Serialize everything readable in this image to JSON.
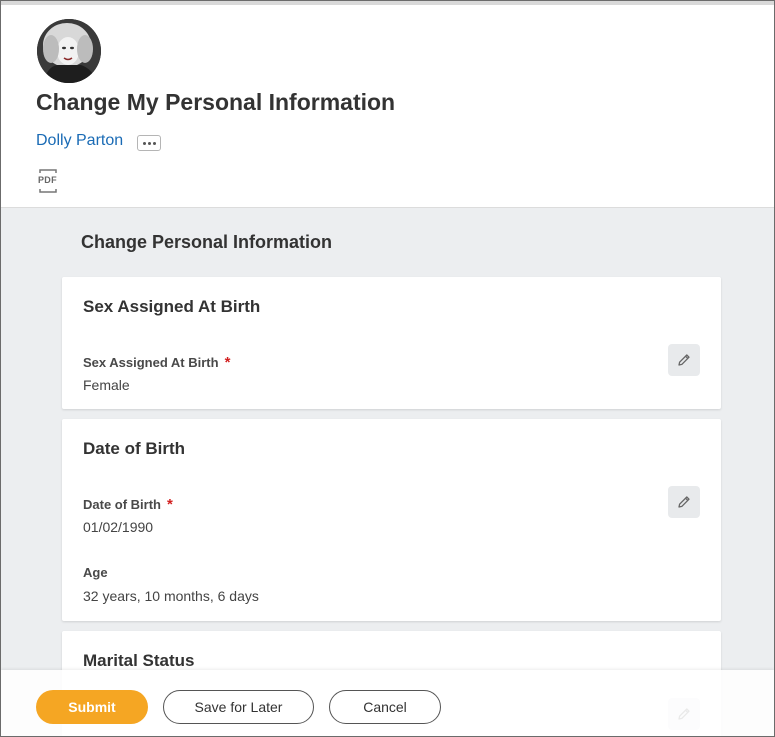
{
  "header": {
    "title": "Change My Personal Information",
    "worker_name": "Dolly Parton",
    "avatar_icon": "profile-photo",
    "related_actions_icon": "more-horizontal-icon",
    "export_icon": "pdf-icon",
    "pdf_label": "PDF"
  },
  "main": {
    "section_title": "Change Personal Information",
    "cards": [
      {
        "title": "Sex Assigned At Birth",
        "fields": [
          {
            "label": "Sex Assigned At Birth",
            "required": "*",
            "value": "Female"
          }
        ]
      },
      {
        "title": "Date of Birth",
        "fields": [
          {
            "label": "Date of Birth",
            "required": "*",
            "value": "01/02/1990"
          },
          {
            "label": "Age",
            "value": "32 years, 10 months, 6 days"
          }
        ]
      },
      {
        "title": "Marital Status",
        "fields": []
      }
    ]
  },
  "footer": {
    "submit_label": "Submit",
    "save_label": "Save for Later",
    "cancel_label": "Cancel"
  },
  "colors": {
    "accent": "#f5a623",
    "link": "#1a6bb5",
    "required": "#d21f1f",
    "background": "#eceef0"
  }
}
